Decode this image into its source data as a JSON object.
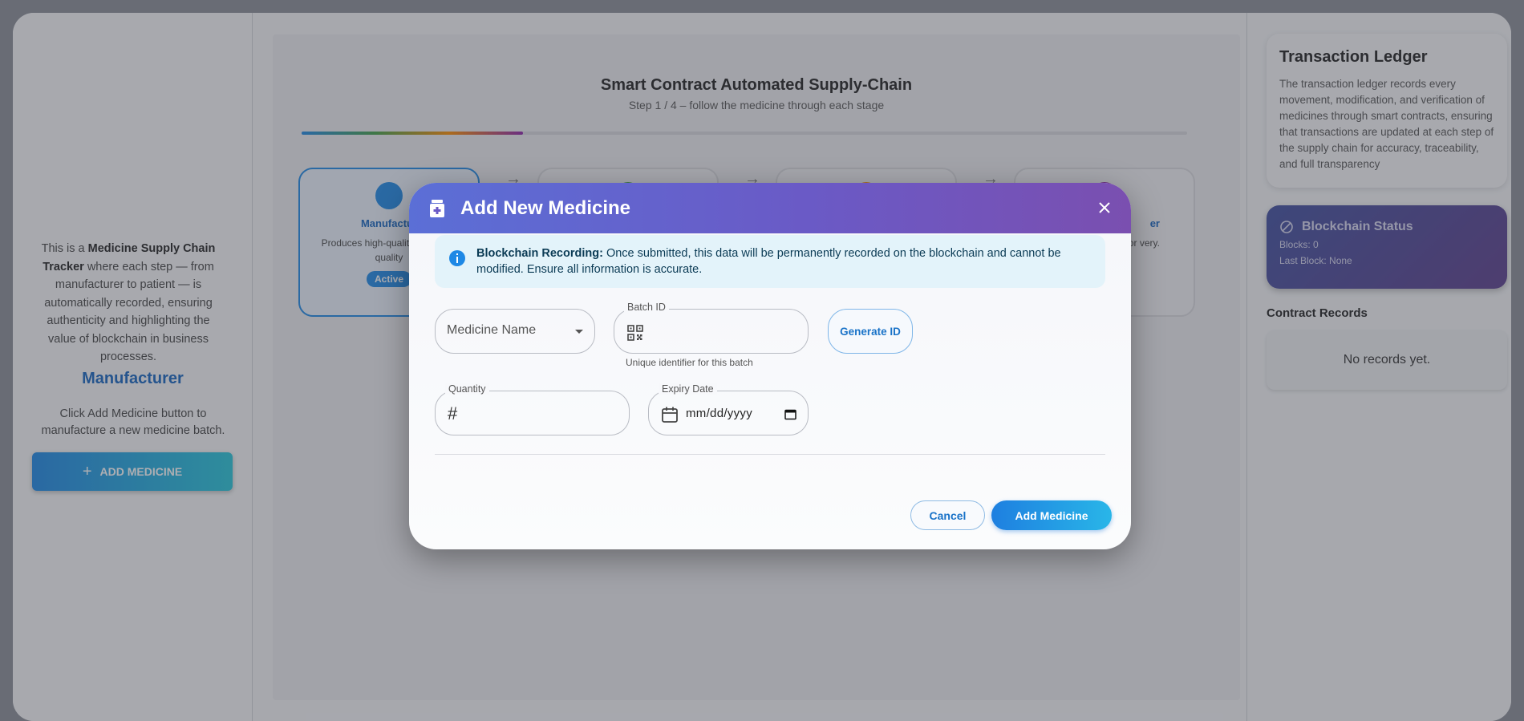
{
  "left_sidebar": {
    "intro_prefix": "This is a ",
    "intro_bold": "Medicine Supply Chain Tracker",
    "intro_suffix": " where each step — from manufacturer to patient — is automatically recorded, ensuring authenticity and highlighting the value of blockchain in business processes.",
    "role_title": "Manufacturer",
    "role_hint": "Click Add Medicine button to manufacture a new medicine batch.",
    "add_button_label": "ADD MEDICINE"
  },
  "main": {
    "title": "Smart Contract Automated Supply-Chain",
    "subtitle": "Step 1 / 4 – follow the medicine through each stage",
    "progress_fraction": 0.25,
    "steps": [
      {
        "name": "Manufactur",
        "desc": "Produces high-quality with strict quality",
        "badge": "Active",
        "color": "#1e88e5"
      },
      {
        "name": "",
        "desc": "",
        "badge": "",
        "color": "#43a047"
      },
      {
        "name": "",
        "desc": "",
        "badge": "",
        "color": "#fb8c00"
      },
      {
        "name": "er",
        "desc": "s for very.",
        "badge": "",
        "color": "#8e24aa"
      }
    ]
  },
  "right_panel": {
    "ledger_title": "Transaction Ledger",
    "ledger_text": "The transaction ledger records every movement, modification, and verification of medicines through smart contracts, ensuring that transactions are updated at each step of the supply chain for accuracy, traceability, and full transparency",
    "status_title": "Blockchain Status",
    "blocks_line": "Blocks: 0",
    "last_block_line": "Last Block: None",
    "records_title": "Contract Records",
    "records_empty": "No records yet."
  },
  "modal": {
    "title": "Add New Medicine",
    "alert_bold": "Blockchain Recording:",
    "alert_text": " Once submitted, this data will be permanently recorded on the blockchain and cannot be modified. Ensure all information is accurate.",
    "medicine_placeholder": "Medicine Name",
    "batch_label": "Batch ID",
    "batch_value": "",
    "batch_helper": "Unique identifier for this batch",
    "generate_label": "Generate ID",
    "quantity_label": "Quantity",
    "quantity_value": "",
    "expiry_label": "Expiry Date",
    "expiry_value": "mm/dd/yyyy",
    "cancel_label": "Cancel",
    "submit_label": "Add Medicine"
  },
  "colors": {
    "accent": "#1e88e5",
    "header_start": "#5b6fd6",
    "header_end": "#7a4fb0"
  }
}
